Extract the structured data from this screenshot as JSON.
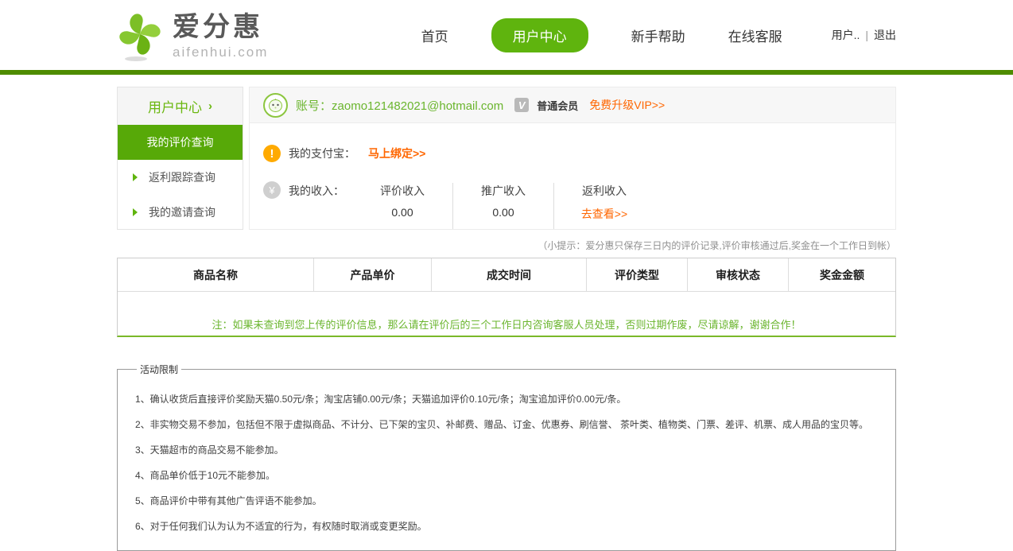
{
  "colors": {
    "green": "#5fb40e",
    "green_dark": "#4e8c00",
    "green_text": "#6ab52d",
    "orange": "#ff6600"
  },
  "brand": {
    "name_cn": "爱分惠",
    "domain": "aifenhui.com"
  },
  "nav": {
    "items": [
      {
        "label": "首页",
        "active": false
      },
      {
        "label": "用户中心",
        "active": true
      },
      {
        "label": "新手帮助",
        "active": false
      },
      {
        "label": "在线客服",
        "active": false
      }
    ],
    "user": "用户..",
    "separator": "|",
    "logout": "退出"
  },
  "sidebar": {
    "title": "用户中心",
    "chevron": "›",
    "items": [
      {
        "label": "我的评价查询",
        "active": true
      },
      {
        "label": "返利跟踪查询",
        "active": false
      },
      {
        "label": "我的邀请查询",
        "active": false
      }
    ]
  },
  "account": {
    "label": "账号：",
    "email": "zaomo121482021@hotmail.com",
    "vip_badge": "V",
    "member_level": "普通会员",
    "upgrade_link": "免费升级VIP>>"
  },
  "alipay": {
    "icon": "!",
    "label": "我的支付宝：",
    "bind_link": "马上绑定>>"
  },
  "income": {
    "icon": "¥",
    "label": "我的收入：",
    "columns": [
      {
        "title": "评价收入",
        "value": "0.00"
      },
      {
        "title": "推广收入",
        "value": "0.00"
      },
      {
        "title": "返利收入",
        "link": "去查看>>"
      }
    ]
  },
  "tip": "（小提示：爱分惠只保存三日内的评价记录,评价审核通过后,奖金在一个工作日到帐）",
  "table": {
    "headers": [
      "商品名称",
      "产品单价",
      "成交时间",
      "评价类型",
      "审核状态",
      "奖金金额"
    ],
    "note": "注：如果未查询到您上传的评价信息，那么请在评价后的三个工作日内咨询客服人员处理，否则过期作废，尽请谅解，谢谢合作！"
  },
  "rules": {
    "legend": "活动限制",
    "items": [
      "1、确认收货后直接评价奖励天猫0.50元/条；淘宝店铺0.00元/条；天猫追加评价0.10元/条；淘宝追加评价0.00元/条。",
      "2、非实物交易不参加，包括但不限于虚拟商品、不计分、已下架的宝贝、补邮费、赠品、订金、优惠券、刷信誉、 茶叶类、植物类、门票、差评、机票、成人用品的宝贝等。",
      "3、天猫超市的商品交易不能参加。",
      "4、商品单价低于10元不能参加。",
      "5、商品评价中带有其他广告评语不能参加。",
      "6、对于任何我们认为认为不适宜的行为，有权随时取消或变更奖励。"
    ]
  }
}
